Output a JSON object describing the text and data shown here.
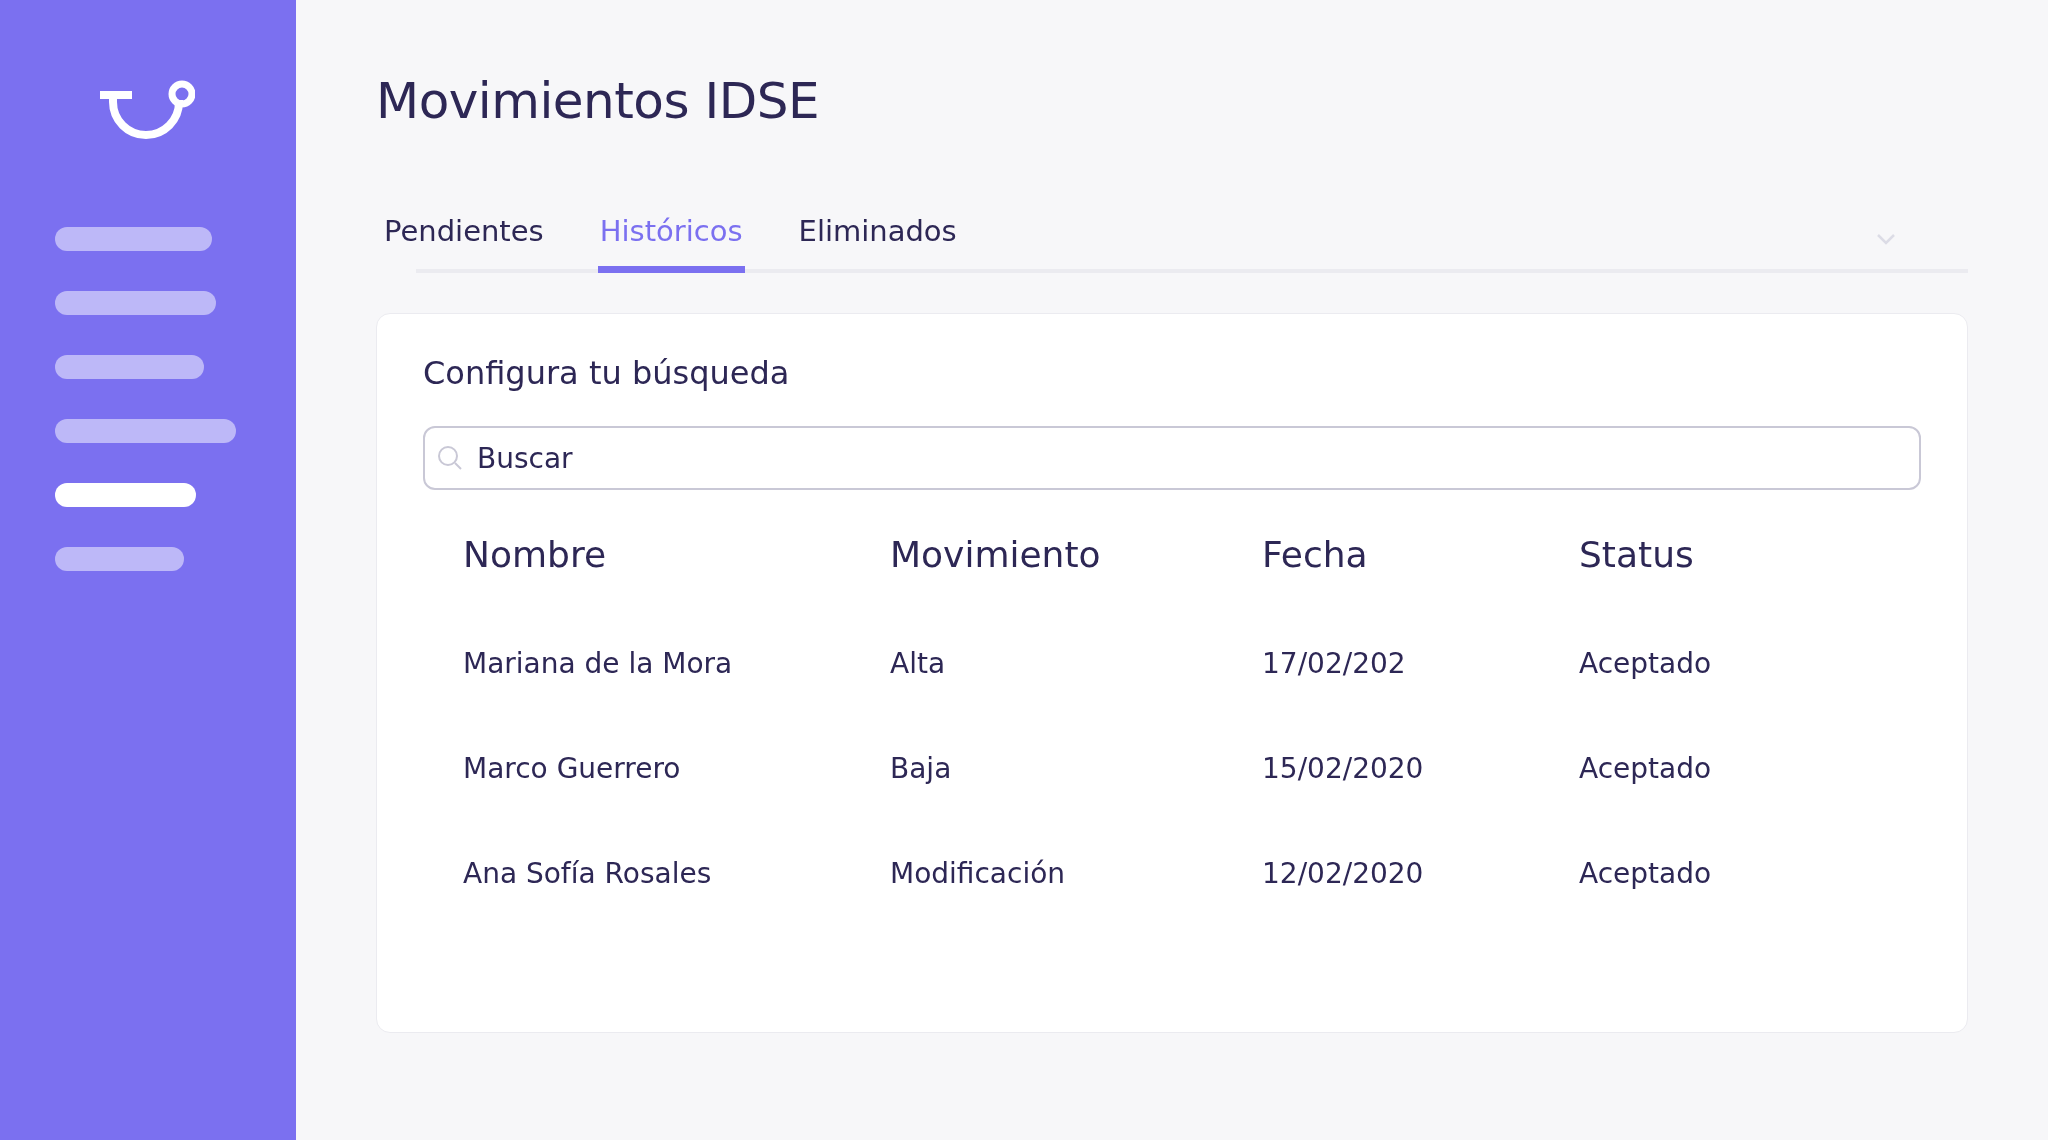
{
  "sidebar": {
    "items": [
      {
        "selected": false
      },
      {
        "selected": false
      },
      {
        "selected": false
      },
      {
        "selected": false
      },
      {
        "selected": true
      },
      {
        "selected": false
      }
    ]
  },
  "page": {
    "title": "Movimientos IDSE"
  },
  "tabs": [
    {
      "label": "Pendientes",
      "selected": false
    },
    {
      "label": "Históricos",
      "selected": true
    },
    {
      "label": "Eliminados",
      "selected": false
    }
  ],
  "search_panel": {
    "title": "Configura tu búsqueda",
    "search": {
      "value": "Buscar"
    }
  },
  "table": {
    "columns": [
      "Nombre",
      "Movimiento",
      "Fecha",
      "Status"
    ],
    "rows": [
      [
        "Mariana de la Mora",
        "Alta",
        "17/02/202",
        "Aceptado"
      ],
      [
        "Marco Guerrero",
        "Baja",
        "15/02/2020",
        "Aceptado"
      ],
      [
        "Ana Sofía Rosales",
        "Modificación",
        "12/02/2020",
        "Aceptado"
      ]
    ]
  }
}
